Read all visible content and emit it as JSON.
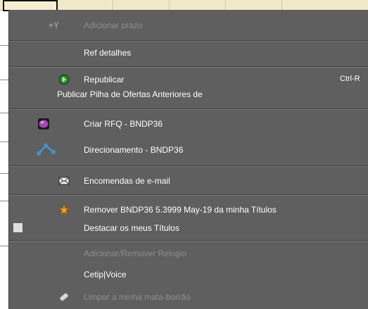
{
  "menu": {
    "items": [
      {
        "label": "Adicionar prazo",
        "icon": "plus-y-text-icon",
        "icon_text": "+Y",
        "enabled": false
      },
      {
        "label": "Ref detalhes",
        "enabled": true
      },
      {
        "label": "Republicar",
        "icon": "green-circle-arrow-icon",
        "shortcut": "Ctrl-R",
        "enabled": true
      },
      {
        "label": "Publicar Pilha de Ofertas Anteriores de",
        "enabled": true
      },
      {
        "label": "Criar RFQ - BNDP36",
        "icon": "purple-rfq-icon",
        "enabled": true
      },
      {
        "label": "Direcionamento - BNDP36",
        "icon": "routing-nodes-icon",
        "enabled": true
      },
      {
        "label": "Encomendas de e-mail",
        "icon": "envelope-icon",
        "enabled": true
      },
      {
        "label": "Remover BNDP36 5.3999 May-19 da minha Títulos",
        "icon": "orange-star-icon",
        "enabled": true
      },
      {
        "label": "Destacar os meus Títulos",
        "icon": "white-square-icon",
        "enabled": true
      },
      {
        "label": "Adicionar/Remover Relogio",
        "enabled": false
      },
      {
        "label": "Cetip|Voice",
        "enabled": true
      },
      {
        "label": "Limpar a minha mata-borrão",
        "icon": "eraser-icon",
        "enabled": false
      }
    ]
  },
  "colors": {
    "menu_background": "#5f5f5f",
    "text_enabled": "#ffffff",
    "text_disabled": "#8d8d8d",
    "separator": "#3f3f3f"
  }
}
